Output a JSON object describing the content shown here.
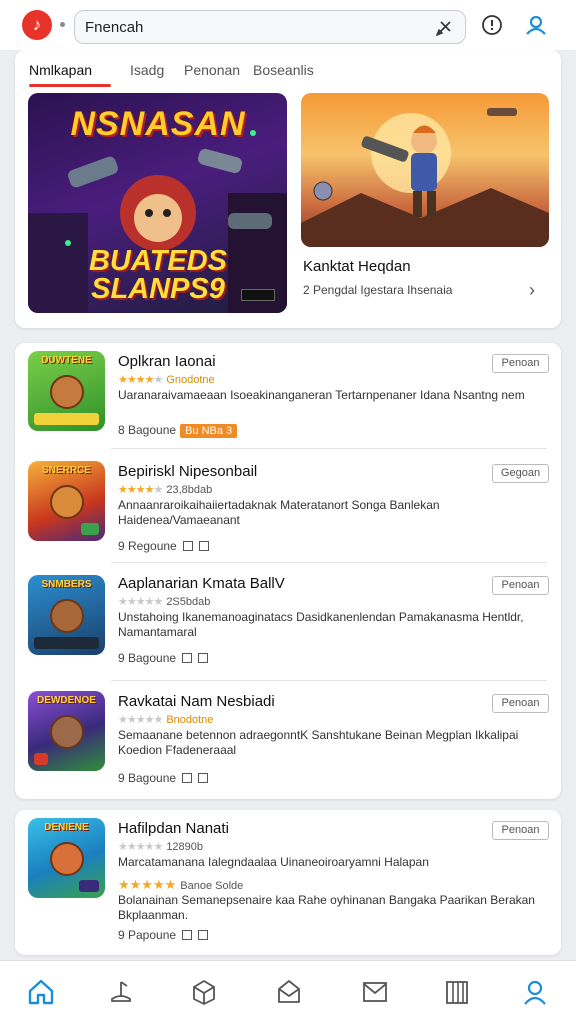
{
  "search": {
    "value": "Fnencah"
  },
  "tabs": [
    "Nmlkapan",
    "Isadg",
    "Penonan",
    "Boseanlis"
  ],
  "featured": {
    "left_banner": {
      "title": "NSNASAN",
      "subtitle": "BUATEDS SLANPS9"
    },
    "right_title": "Kanktat Heqdan",
    "right_meta": "2 Pengdal Igestara Ihsenaia"
  },
  "apps": [
    {
      "icon_label": "DUWTENE",
      "name": "Oplkran Iaonai",
      "rating": 3.5,
      "rating_text": "Gnodotne",
      "desc": "Uaranaraivamaeaan Isoeakinanganeran Tertarnpenaner Idana Nsantng nem",
      "meta": "8 Bagoune",
      "badge": "Bu NBa 3",
      "button": "Penoan",
      "accent": "#4caf3a"
    },
    {
      "icon_label": "SNERRCE",
      "name": "Bepiriskl Nipesonbail",
      "rating": 3.5,
      "rating_text": "23,8bdab",
      "desc": "Annaanraroikaihaiiertadaknak Materatanort Songa Banlekan Haidenea/Vamaeanant",
      "meta": "9 Regoune",
      "button": "Gegoan",
      "accent": "#e0561e"
    },
    {
      "icon_label": "SNMBERS",
      "name": "Aaplanarian Kmata BallV",
      "rating": 0,
      "rating_text": "2S5bdab",
      "desc": "Unstahoing Ikanemanoaginatacs Dasidkanenlendan Pamakanasma Hentldr, Namantamaral",
      "meta": "9 Bagoune",
      "button": "Penoan",
      "accent": "#1f7fb8"
    },
    {
      "icon_label": "DEWDENOE",
      "name": "Ravkatai Nam Nesbiadi",
      "rating": 0,
      "rating_text": "Bnodotne",
      "desc": "Semaanane betennon adraegonntK Sanshtukane Beinan Megplan Ikkalipai Koedion Ffadeneraaal",
      "meta": "9 Bagoune",
      "button": "Penoan",
      "accent": "#6a3fb5"
    },
    {
      "icon_label": "DENIENE",
      "name": "Hafilpdan Nanati",
      "rating": 0,
      "rating_text": "12890b",
      "desc": "Marcatamanana Ialegndaalaa Uinaneoiroaryamni Halapan",
      "stars2": 5,
      "rating_text2": "Banoe Solde",
      "desc2": "Bolanainan Semanepsenaire kaa Rahe oyhinanan Bangaka Paarikan Berakan Bkplaanman.",
      "meta": "9 Papoune",
      "button": "Penoan",
      "accent": "#1f9fd6"
    }
  ],
  "colors": {
    "accent": "#e8332a",
    "nav_active": "#1a8fd8",
    "star": "#f5a623"
  }
}
